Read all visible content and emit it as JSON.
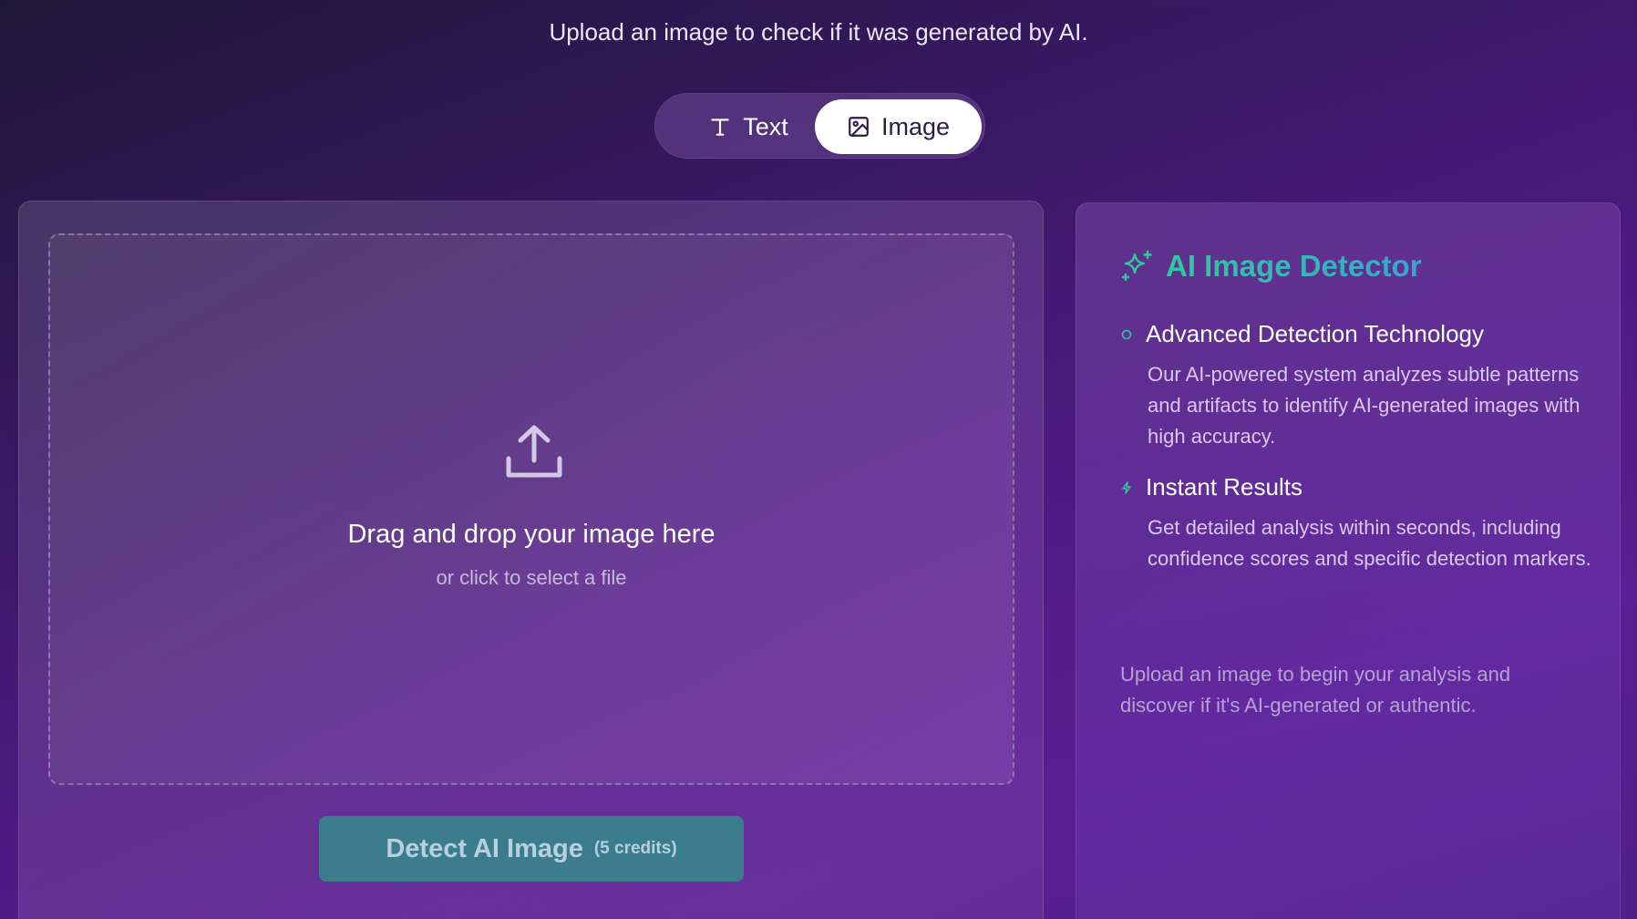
{
  "header": {
    "subtitle": "Upload an image to check if it was generated by AI."
  },
  "mode_toggle": {
    "text_label": "Text",
    "image_label": "Image",
    "selected": "Image"
  },
  "upload": {
    "title": "Drag and drop your image here",
    "subtitle": "or click to select a file"
  },
  "detect_button": {
    "label": "Detect AI Image",
    "credits": "(5 credits)"
  },
  "info_panel": {
    "title": "AI Image Detector",
    "features": [
      {
        "title": "Advanced Detection Technology",
        "description": "Our AI-powered system analyzes subtle patterns and artifacts to identify AI-generated images with high accuracy."
      },
      {
        "title": "Instant Results",
        "description": "Get detailed analysis within seconds, including confidence scores and specific detection markers."
      }
    ],
    "footer": "Upload an image to begin your analysis and discover if it's AI-generated or authentic."
  },
  "colors": {
    "accent_green": "#2fc99e",
    "accent_blue": "#3aa5cf",
    "button_teal": "#3b7d8c"
  }
}
